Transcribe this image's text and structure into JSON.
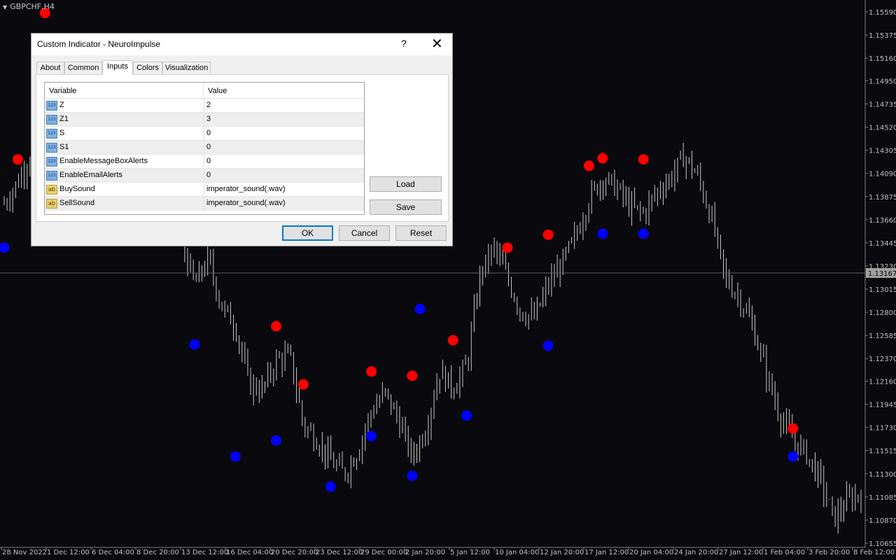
{
  "chart": {
    "symbol": "GBPCHF,H4",
    "current_price": "1.13167",
    "price_ticks": [
      "1.15590",
      "1.15375",
      "1.15160",
      "1.14950",
      "1.14735",
      "1.14520",
      "1.14305",
      "1.14090",
      "1.13875",
      "1.13660",
      "1.13445",
      "1.13230",
      "1.13015",
      "1.12800",
      "1.12585",
      "1.12370",
      "1.12160",
      "1.11945",
      "1.11730",
      "1.11515",
      "1.11300",
      "1.11085",
      "1.10870",
      "1.10655"
    ],
    "time_ticks": [
      "28 Nov 2022",
      "1 Dec 12:00",
      "6 Dec 04:00",
      "8 Dec 20:00",
      "13 Dec 12:00",
      "16 Dec 04:00",
      "20 Dec 20:00",
      "23 Dec 12:00",
      "29 Dec 00:00",
      "2 Jan 20:00",
      "5 Jan 12:00",
      "10 Jan 04:00",
      "12 Jan 20:00",
      "17 Jan 12:00",
      "20 Jan 04:00",
      "24 Jan 20:00",
      "27 Jan 12:00",
      "1 Feb 04:00",
      "3 Feb 20:00",
      "8 Feb 12:00"
    ],
    "colors": {
      "background": "#0a0a0e",
      "bars": "#c8c8c8",
      "sell_signal": "#ff0000",
      "buy_signal": "#0000ff",
      "axis": "#c0c0c0"
    }
  },
  "chart_data": {
    "type": "scatter",
    "title": "GBPCHF,H4",
    "ylim": [
      1.10655,
      1.15805
    ],
    "close_series": [
      {
        "t": "28 Nov 2022",
        "price": 1.1381
      },
      {
        "t": "29 Nov",
        "price": 1.1401
      },
      {
        "t": "30 Nov",
        "price": 1.1428
      },
      {
        "t": "1 Dec 12:00",
        "price": 1.144
      },
      {
        "t": "2 Dec",
        "price": 1.147
      },
      {
        "t": "5 Dec",
        "price": 1.1462
      },
      {
        "t": "6 Dec 04:00",
        "price": 1.148
      },
      {
        "t": "7 Dec",
        "price": 1.1445
      },
      {
        "t": "8 Dec 20:00",
        "price": 1.1428
      },
      {
        "t": "9 Dec",
        "price": 1.14
      },
      {
        "t": "12 Dec",
        "price": 1.1385
      },
      {
        "t": "13 Dec 12:00",
        "price": 1.1376
      },
      {
        "t": "14 Dec",
        "price": 1.1378
      },
      {
        "t": "15 Dec",
        "price": 1.1348
      },
      {
        "t": "16 Dec 04:00",
        "price": 1.1305
      },
      {
        "t": "16 Dec 20:00",
        "price": 1.133
      },
      {
        "t": "19 Dec",
        "price": 1.1285
      },
      {
        "t": "20 Dec 20:00",
        "price": 1.1268
      },
      {
        "t": "21 Dec",
        "price": 1.1213
      },
      {
        "t": "22 Dec",
        "price": 1.1208
      },
      {
        "t": "23 Dec 12:00",
        "price": 1.1235
      },
      {
        "t": "26 Dec",
        "price": 1.124
      },
      {
        "t": "27 Dec",
        "price": 1.1175
      },
      {
        "t": "28 Dec",
        "price": 1.1162
      },
      {
        "t": "29 Dec 00:00",
        "price": 1.1142
      },
      {
        "t": "30 Dec",
        "price": 1.113
      },
      {
        "t": "2 Jan",
        "price": 1.1151
      },
      {
        "t": "2 Jan 20:00",
        "price": 1.1188
      },
      {
        "t": "3 Jan",
        "price": 1.1205
      },
      {
        "t": "4 Jan",
        "price": 1.118
      },
      {
        "t": "5 Jan 12:00",
        "price": 1.1145
      },
      {
        "t": "6 Jan",
        "price": 1.1172
      },
      {
        "t": "9 Jan",
        "price": 1.1225
      },
      {
        "t": "9 Jan 20:00",
        "price": 1.121
      },
      {
        "t": "10 Jan 04:00",
        "price": 1.123
      },
      {
        "t": "11 Jan",
        "price": 1.1316
      },
      {
        "t": "12 Jan",
        "price": 1.134
      },
      {
        "t": "12 Jan 20:00",
        "price": 1.1312
      },
      {
        "t": "13 Jan",
        "price": 1.128
      },
      {
        "t": "16 Jan",
        "price": 1.1275
      },
      {
        "t": "17 Jan 12:00",
        "price": 1.1305
      },
      {
        "t": "18 Jan",
        "price": 1.1325
      },
      {
        "t": "19 Jan",
        "price": 1.135
      },
      {
        "t": "20 Jan 04:00",
        "price": 1.1385
      },
      {
        "t": "20 Jan 20:00",
        "price": 1.1405
      },
      {
        "t": "23 Jan",
        "price": 1.1396
      },
      {
        "t": "24 Jan",
        "price": 1.1378
      },
      {
        "t": "24 Jan 20:00",
        "price": 1.1372
      },
      {
        "t": "25 Jan",
        "price": 1.1392
      },
      {
        "t": "26 Jan",
        "price": 1.1405
      },
      {
        "t": "27 Jan 12:00",
        "price": 1.1425
      },
      {
        "t": "30 Jan",
        "price": 1.1406
      },
      {
        "t": "31 Jan",
        "price": 1.1368
      },
      {
        "t": "31 Jan 12:00",
        "price": 1.1312
      },
      {
        "t": "1 Feb 04:00",
        "price": 1.1295
      },
      {
        "t": "1 Feb 20:00",
        "price": 1.1268
      },
      {
        "t": "2 Feb",
        "price": 1.1225
      },
      {
        "t": "2 Feb 12:00",
        "price": 1.1185
      },
      {
        "t": "3 Feb 20:00",
        "price": 1.1162
      },
      {
        "t": "6 Feb",
        "price": 1.1148
      },
      {
        "t": "7 Feb",
        "price": 1.1125
      },
      {
        "t": "7 Feb 12:00",
        "price": 1.1088
      },
      {
        "t": "8 Feb",
        "price": 1.1105
      },
      {
        "t": "8 Feb 12:00",
        "price": 1.1112
      }
    ],
    "sell_signals": [
      {
        "t": "1 Dec 12:00",
        "price": 1.1558
      },
      {
        "t": "29 Nov",
        "price": 1.1422
      },
      {
        "t": "23 Dec 12:00",
        "price": 1.1267
      },
      {
        "t": "27 Dec",
        "price": 1.1213
      },
      {
        "t": "2 Jan 20:00",
        "price": 1.1225
      },
      {
        "t": "5 Jan 12:00",
        "price": 1.1221
      },
      {
        "t": "9 Jan 20:00",
        "price": 1.1254
      },
      {
        "t": "12 Jan 20:00",
        "price": 1.134
      },
      {
        "t": "17 Jan 12:00",
        "price": 1.1352
      },
      {
        "t": "20 Jan 04:00",
        "price": 1.1416
      },
      {
        "t": "20 Jan 20:00",
        "price": 1.1423
      },
      {
        "t": "24 Jan 20:00",
        "price": 1.1422
      },
      {
        "t": "3 Feb 20:00",
        "price": 1.1172
      }
    ],
    "buy_signals": [
      {
        "t": "28 Nov 2022",
        "price": 1.134
      },
      {
        "t": "16 Dec 04:00",
        "price": 1.125
      },
      {
        "t": "20 Dec 20:00",
        "price": 1.1146
      },
      {
        "t": "23 Dec 12:00",
        "price": 1.1161
      },
      {
        "t": "29 Dec 00:00",
        "price": 1.1118
      },
      {
        "t": "2 Jan 20:00",
        "price": 1.1165
      },
      {
        "t": "5 Jan 12:00",
        "price": 1.1128
      },
      {
        "t": "10 Jan 04:00",
        "price": 1.1184
      },
      {
        "t": "17 Jan 12:00",
        "price": 1.1249
      },
      {
        "t": "17 Jan 20:00",
        "price": 1.1283
      },
      {
        "t": "20 Jan 20:00",
        "price": 1.1353
      },
      {
        "t": "24 Jan 20:00",
        "price": 1.1353
      },
      {
        "t": "3 Feb 20:00",
        "price": 1.1146
      }
    ]
  },
  "dialog": {
    "title": "Custom Indicator - NeuroImpulse",
    "help_label": "?",
    "close_label": "✕",
    "tabs": [
      {
        "label": "About"
      },
      {
        "label": "Common"
      },
      {
        "label": "Inputs"
      },
      {
        "label": "Colors"
      },
      {
        "label": "Visualization"
      }
    ],
    "active_tab": "Inputs",
    "table": {
      "col_variable": "Variable",
      "col_value": "Value",
      "rows": [
        {
          "type": "num",
          "icon": "123",
          "variable": "Z",
          "value": "2"
        },
        {
          "type": "num",
          "icon": "123",
          "variable": "Z1",
          "value": "3"
        },
        {
          "type": "num",
          "icon": "123",
          "variable": "S",
          "value": "0"
        },
        {
          "type": "num",
          "icon": "123",
          "variable": "S1",
          "value": "0"
        },
        {
          "type": "num",
          "icon": "123",
          "variable": "EnableMessageBoxAlerts",
          "value": "0"
        },
        {
          "type": "num",
          "icon": "123",
          "variable": "EnableEmailAlerts",
          "value": "0"
        },
        {
          "type": "str",
          "icon": "ab",
          "variable": "BuySound",
          "value": "imperator_sound(.wav)"
        },
        {
          "type": "str",
          "icon": "ab",
          "variable": "SellSound",
          "value": "imperator_sound(.wav)"
        }
      ]
    },
    "buttons": {
      "load": "Load",
      "save": "Save",
      "ok": "OK",
      "cancel": "Cancel",
      "reset": "Reset"
    }
  }
}
